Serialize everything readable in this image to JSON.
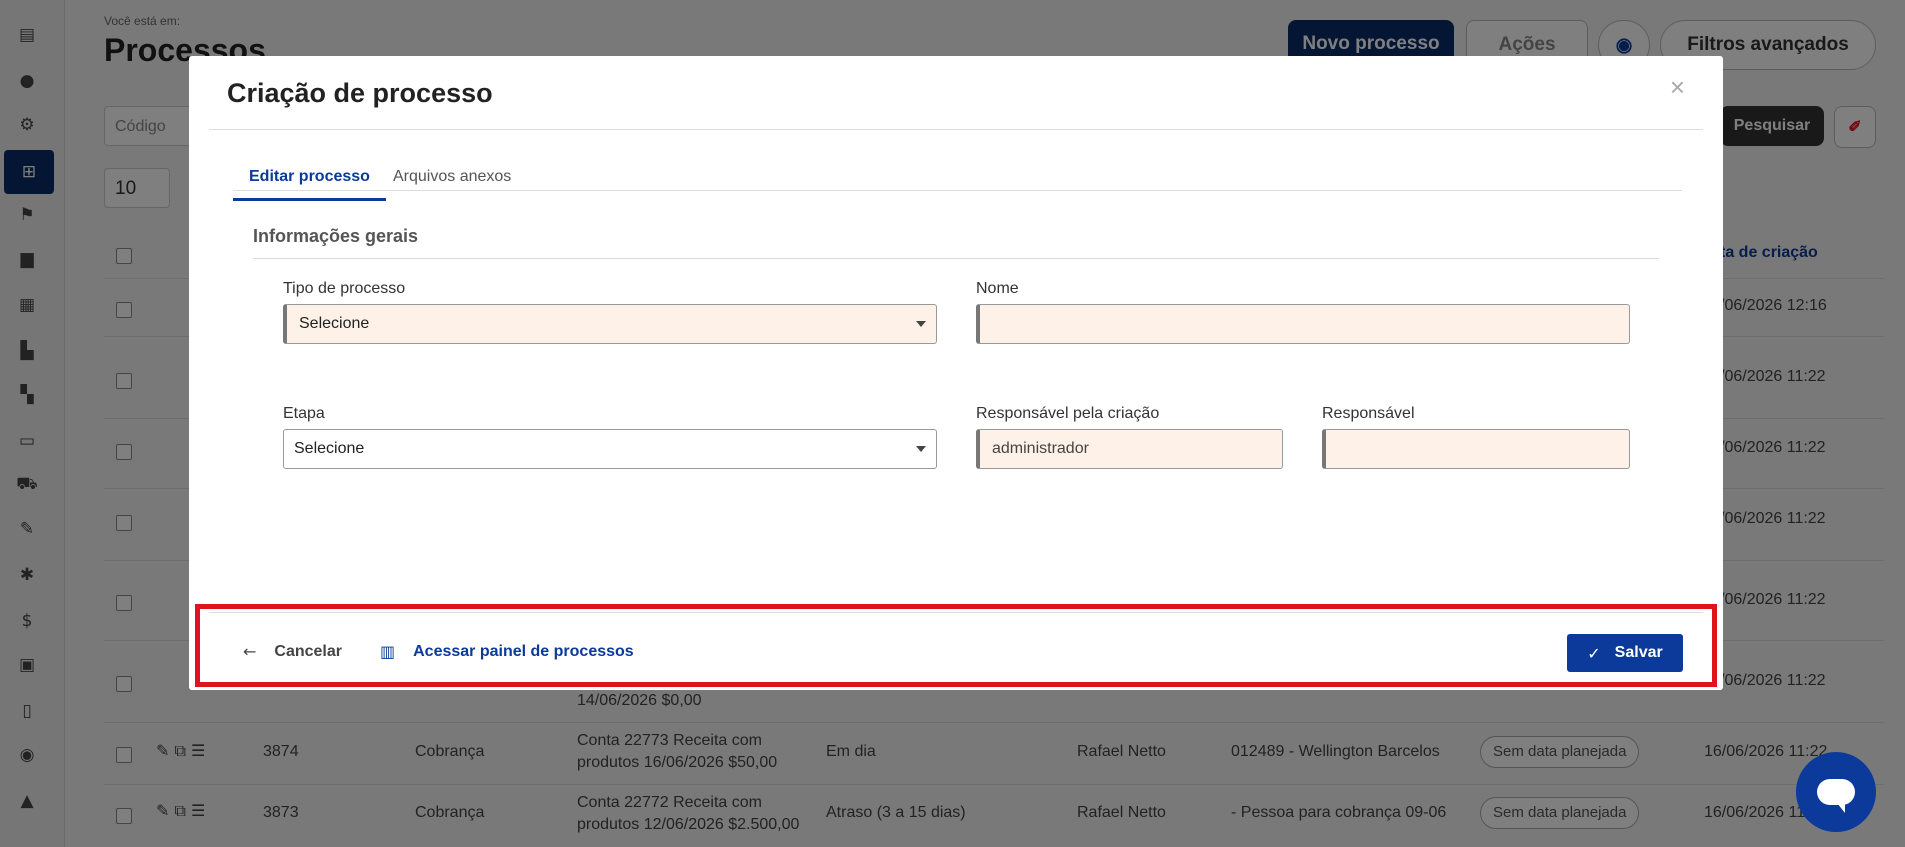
{
  "background": {
    "breadcrumb": "Você está em:",
    "title": "Processos",
    "new_process_button": "Novo processo",
    "actions_button": "Ações",
    "advanced_filters_button": "Filtros avançados",
    "code_placeholder": "Código",
    "search_button": "Pesquisar",
    "page_size": "10",
    "column_created": "ta de criação",
    "row_dates": [
      "/06/2026 12:16",
      "/06/2026 11:22",
      "/06/2026 11:22",
      "/06/2026 11:22",
      "/06/2026 11:22",
      "/06/2026 11:22"
    ],
    "partial_row_text": "14/06/2026 $0,00",
    "rows": [
      {
        "id": "3874",
        "type": "Cobrança",
        "desc_line1": "Conta 22773 Receita com",
        "desc_line2": "produtos 16/06/2026 $50,00",
        "status": "Em dia",
        "responsible": "Rafael Netto",
        "client": "012489 - Wellington Barcelos",
        "planned": "Sem data planejada",
        "created": "16/06/2026 11:22"
      },
      {
        "id": "3873",
        "type": "Cobrança",
        "desc_line1": "Conta 22772 Receita com",
        "desc_line2": "produtos 12/06/2026 $2.500,00",
        "status": "Atraso (3 a 15 dias)",
        "responsible": "Rafael Netto",
        "client": "- Pessoa para cobrança 09-06",
        "planned": "Sem data planejada",
        "created": "16/06/2026 11"
      }
    ]
  },
  "modal": {
    "title": "Criação de processo",
    "close_symbol": "×",
    "tabs": [
      {
        "label": "Editar processo",
        "active": true
      },
      {
        "label": "Arquivos anexos",
        "active": false
      }
    ],
    "section_title": "Informações gerais",
    "fields": {
      "process_type": {
        "label": "Tipo de processo",
        "value": "Selecione"
      },
      "name": {
        "label": "Nome",
        "value": ""
      },
      "stage": {
        "label": "Etapa",
        "value": "Selecione"
      },
      "created_by": {
        "label": "Responsável pela criação",
        "value": "administrador"
      },
      "responsible": {
        "label": "Responsável",
        "value": ""
      }
    },
    "footer": {
      "cancel_label": "Cancelar",
      "panel_label": "Acessar painel de processos",
      "save_label": "Salvar"
    }
  },
  "colors": {
    "primary": "#0b3a9b",
    "highlight": "#e0141e",
    "required_field_bg": "#fdf1e8"
  }
}
